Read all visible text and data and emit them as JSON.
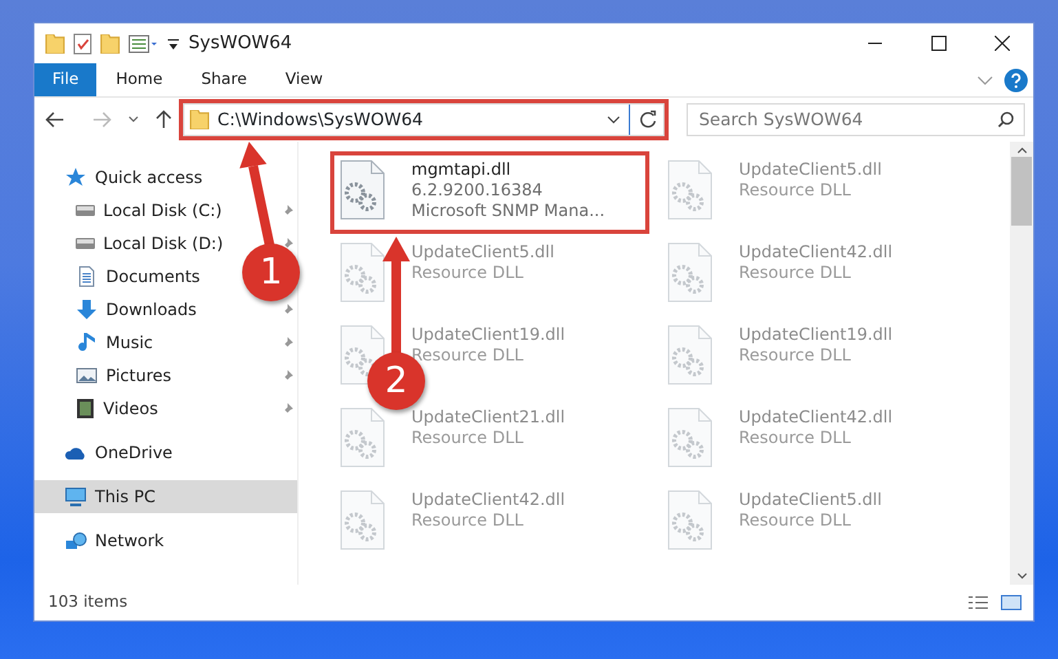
{
  "window": {
    "title": "SysWOW64"
  },
  "ribbon_tabs": [
    {
      "label": "File",
      "kind": "file"
    },
    {
      "label": "Home",
      "kind": "tab"
    },
    {
      "label": "Share",
      "kind": "tab"
    },
    {
      "label": "View",
      "kind": "tab"
    }
  ],
  "address_bar": {
    "path": "C:\\Windows\\SysWOW64",
    "annotated": true
  },
  "search": {
    "placeholder": "Search SysWOW64"
  },
  "sidebar": {
    "items": [
      {
        "label": "Quick access",
        "kind": "star",
        "selected": false,
        "children": [
          {
            "label": "Local Disk (C:)",
            "kind": "drive",
            "pinned": true,
            "selected": false
          },
          {
            "label": "Local Disk (D:)",
            "kind": "drive",
            "pinned": true,
            "selected": false
          },
          {
            "label": "Documents",
            "kind": "document",
            "selected": false
          },
          {
            "label": "Downloads",
            "kind": "download",
            "pinned": true,
            "selected": false
          },
          {
            "label": "Music",
            "kind": "music",
            "pinned": true,
            "selected": false
          },
          {
            "label": "Pictures",
            "kind": "picture",
            "pinned": true,
            "selected": false
          },
          {
            "label": "Videos",
            "kind": "video",
            "pinned": true,
            "selected": false
          }
        ]
      },
      {
        "label": "OneDrive",
        "kind": "cloud",
        "selected": false
      },
      {
        "label": "This PC",
        "kind": "computer",
        "selected": true
      },
      {
        "label": "Network",
        "kind": "network",
        "selected": false
      }
    ]
  },
  "files": [
    {
      "name": "mgmtapi.dll",
      "details": [
        "6.2.9200.16384",
        "Microsoft SNMP Mana..."
      ],
      "annotated": true,
      "dimmed": false
    },
    {
      "name": "UpdateClient5.dll",
      "details": [
        "Resource DLL"
      ],
      "annotated": false,
      "dimmed": true
    },
    {
      "name": "UpdateClient5.dll",
      "details": [
        "Resource DLL"
      ],
      "annotated": false,
      "dimmed": true
    },
    {
      "name": "UpdateClient42.dll",
      "details": [
        "Resource DLL"
      ],
      "annotated": false,
      "dimmed": true
    },
    {
      "name": "UpdateClient19.dll",
      "details": [
        "Resource DLL"
      ],
      "annotated": false,
      "dimmed": true
    },
    {
      "name": "UpdateClient19.dll",
      "details": [
        "Resource DLL"
      ],
      "annotated": false,
      "dimmed": true
    },
    {
      "name": "UpdateClient21.dll",
      "details": [
        "Resource DLL"
      ],
      "annotated": false,
      "dimmed": true
    },
    {
      "name": "UpdateClient42.dll",
      "details": [
        "Resource DLL"
      ],
      "annotated": false,
      "dimmed": true
    },
    {
      "name": "UpdateClient42.dll",
      "details": [
        "Resource DLL"
      ],
      "annotated": false,
      "dimmed": true
    },
    {
      "name": "UpdateClient5.dll",
      "details": [
        "Resource DLL"
      ],
      "annotated": false,
      "dimmed": true
    }
  ],
  "status_bar": {
    "count": "103 items"
  },
  "annotations": [
    {
      "label": "1"
    },
    {
      "label": "2"
    }
  ]
}
